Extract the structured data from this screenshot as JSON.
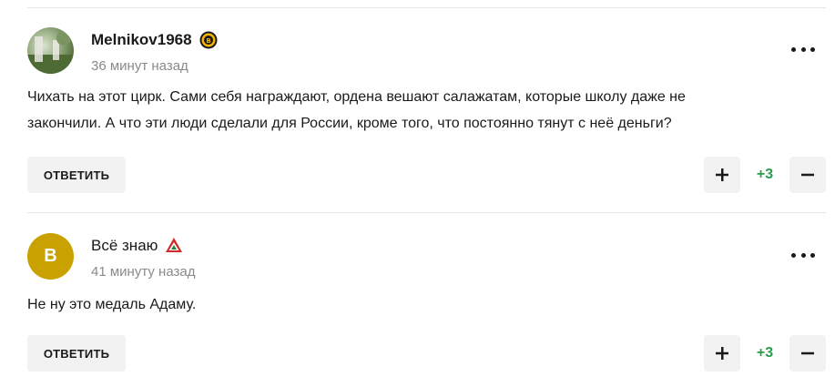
{
  "colors": {
    "vote_positive": "#2a9d4b",
    "button_bg": "#f2f2f2",
    "meta_text": "#8a8a8a",
    "avatar_letter_bg": "#c9a100"
  },
  "comments": [
    {
      "author": "Melnikov1968",
      "badge_icon": "bruins-logo-icon",
      "timestamp": "36 минут назад",
      "text": "Чихать на этот цирк. Сами себя награждают, ордена вешают салажатам, которые школу даже не закончили. А что эти люди сделали для России, кроме того, что постоянно тянут с неё деньги?",
      "reply_label": "ОТВЕТИТЬ",
      "votes": "+3",
      "avatar_icon": "user-photo-avatar"
    },
    {
      "author": "Всё знаю",
      "avatar_letter": "В",
      "badge_icon": "lokomotiv-logo-icon",
      "timestamp": "41 минуту назад",
      "text": "Не ну это медаль Адаму.",
      "reply_label": "ОТВЕТИТЬ",
      "votes": "+3"
    }
  ]
}
